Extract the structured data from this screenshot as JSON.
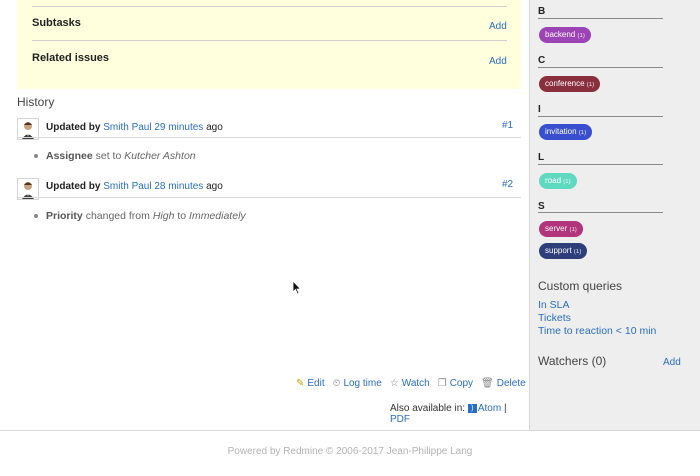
{
  "issue_sections": {
    "subtasks": {
      "title": "Subtasks",
      "add_label": "Add"
    },
    "related": {
      "title": "Related issues",
      "add_label": "Add"
    }
  },
  "history": {
    "title": "History",
    "journals": [
      {
        "prefix": "Updated by",
        "author": "Smith Paul",
        "time_ago": "29 minutes",
        "suffix": "ago",
        "number": "#1",
        "detail": {
          "field": "Assignee",
          "text1": "set to",
          "value1": "Kutcher Ashton",
          "text2": "",
          "value2": ""
        }
      },
      {
        "prefix": "Updated by",
        "author": "Smith Paul",
        "time_ago": "28 minutes",
        "suffix": "ago",
        "number": "#2",
        "detail": {
          "field": "Priority",
          "text1": "changed from",
          "value1": "High",
          "text2": "to",
          "value2": "Immediately"
        }
      }
    ]
  },
  "actions": {
    "edit": "Edit",
    "log_time": "Log time",
    "watch": "Watch",
    "copy": "Copy",
    "delete": "Delete"
  },
  "export": {
    "label": "Also available in:",
    "atom": "Atom",
    "sep": "|",
    "pdf": "PDF"
  },
  "sidebar": {
    "tag_groups": [
      {
        "letter": "B",
        "tags": [
          {
            "name": "backend",
            "count": "(1)",
            "color": "#9c44b5"
          }
        ]
      },
      {
        "letter": "C",
        "tags": [
          {
            "name": "conference",
            "count": "(1)",
            "color": "#8a2f3d"
          }
        ]
      },
      {
        "letter": "I",
        "tags": [
          {
            "name": "invitation",
            "count": "(1)",
            "color": "#3a4fd0"
          }
        ]
      },
      {
        "letter": "L",
        "tags": [
          {
            "name": "road",
            "count": "(1)",
            "color": "#5fd9c0"
          }
        ]
      },
      {
        "letter": "S",
        "tags": [
          {
            "name": "server",
            "count": "(1)",
            "color": "#b2347a"
          },
          {
            "name": "support",
            "count": "(1)",
            "color": "#2d3e7a"
          }
        ]
      }
    ],
    "custom_queries": {
      "title": "Custom queries",
      "items": [
        "In SLA",
        "Tickets",
        "Time to reaction < 10 min"
      ]
    },
    "watchers": {
      "title": "Watchers (0)",
      "add_label": "Add"
    }
  },
  "footer": {
    "text": "Powered by Redmine © 2006-2017 Jean-Philippe Lang"
  }
}
